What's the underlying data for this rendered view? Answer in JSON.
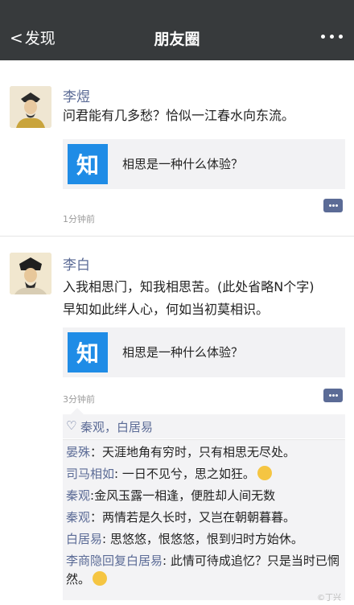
{
  "nav": {
    "back_label": "发现",
    "title": "朋友圈"
  },
  "posts": [
    {
      "name": "李煜",
      "text": [
        "问君能有几多愁？恰似一江春水向东流。"
      ],
      "share": {
        "logo": "知",
        "title": "相思是一种什么体验？"
      },
      "time": "1分钟前"
    },
    {
      "name": "李白",
      "text": [
        "入我相思门，知我相思苦。(此处省略N个字)",
        "早知如此绊人心，何如当初莫相识。"
      ],
      "share": {
        "logo": "知",
        "title": "相思是一种什么体验？"
      },
      "time": "3分钟前"
    }
  ],
  "likes": {
    "names": "秦观，白居易"
  },
  "comments": [
    {
      "author": "晏殊",
      "sep": "：",
      "text": "天涯地角有穷时，只有相思无尽处。"
    },
    {
      "author": "司马相如",
      "sep": ": ",
      "text": "一日不见兮，思之如狂。"
    },
    {
      "author": "秦观",
      "sep": ":",
      "text": "金风玉露一相逢，便胜却人间无数"
    },
    {
      "author": "秦观",
      "sep": "：",
      "text": "两情若是久长时，又岂在朝朝暮暮。"
    },
    {
      "author": "白居易",
      "sep": ": ",
      "text": "思悠悠，恨悠悠，恨到归时方始休。"
    },
    {
      "author": "李商隐回复白居易",
      "sep": ": ",
      "text": "此情可待成追忆？只是当时已惘然。"
    }
  ],
  "watermark": "©丁兴"
}
